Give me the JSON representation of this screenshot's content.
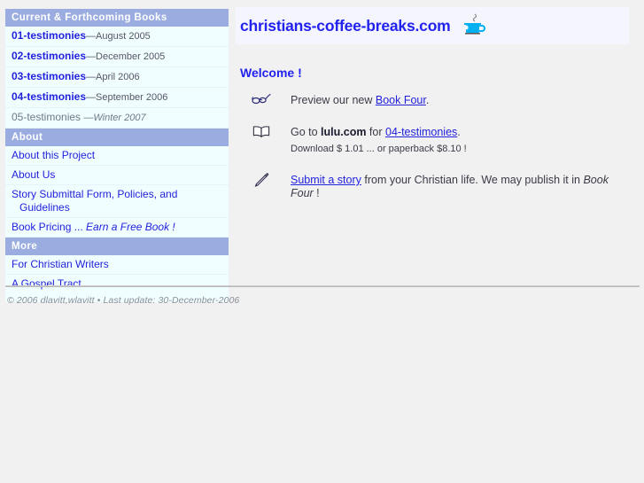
{
  "site": {
    "title": "christians-coffee-breaks.com",
    "logo_icon": "coffee-cup-icon"
  },
  "sidebar": {
    "sections": [
      {
        "header": "Current & Forthcoming Books",
        "items": [
          {
            "label": "01-testimonies",
            "dash": "—",
            "date": "August 2005",
            "link": true,
            "bold": true,
            "italic_date": false
          },
          {
            "label": "02-testimonies",
            "dash": "—",
            "date": "December 2005",
            "link": true,
            "bold": true,
            "italic_date": false
          },
          {
            "label": "03-testimonies",
            "dash": "—",
            "date": "April 2006",
            "link": true,
            "bold": true,
            "italic_date": false
          },
          {
            "label": "04-testimonies",
            "dash": "—",
            "date": "September 2006",
            "link": true,
            "bold": true,
            "italic_date": false
          },
          {
            "label": "05-testimonies",
            "dash": "—",
            "date": "Winter 2007",
            "link": false,
            "bold": false,
            "italic_date": true
          }
        ]
      },
      {
        "header": "About",
        "items": [
          {
            "label": "About this Project",
            "dash": "",
            "date": "",
            "link": true,
            "bold": false,
            "italic_date": false
          },
          {
            "label": "About Us",
            "dash": "",
            "date": "",
            "link": true,
            "bold": false,
            "italic_date": false
          },
          {
            "label": "Story Submittal Form, Policies, and",
            "label2": "Guidelines",
            "dash": "",
            "date": "",
            "link": true,
            "bold": false,
            "italic_date": false
          },
          {
            "label": "Book Pricing ...",
            "emphasis": "Earn a Free Book !",
            "dash": "",
            "date": "",
            "link": true,
            "bold": false,
            "italic_date": false
          }
        ]
      },
      {
        "header": "More",
        "items": [
          {
            "label": "For Christian Writers",
            "dash": "",
            "date": "",
            "link": true,
            "bold": false,
            "italic_date": false
          },
          {
            "label": "A Gospel Tract",
            "dash": "",
            "date": "",
            "link": true,
            "bold": false,
            "italic_date": false
          }
        ]
      }
    ]
  },
  "main": {
    "welcome_heading": "Welcome !",
    "features": [
      {
        "icon": "eyeglasses-icon",
        "text_before": "Preview our new ",
        "link_text": "Book Four",
        "text_after": ".",
        "sub_line": ""
      },
      {
        "icon": "open-book-icon",
        "text_before": "Go to ",
        "strong_text": "lulu.com",
        "text_middle": " for ",
        "link_text": "04-testimonies",
        "text_after": ".",
        "sub_line": "Download $ 1.01 ... or paperback $8.10 !"
      },
      {
        "icon": "pencil-icon",
        "link_text": "Submit a story",
        "text_after": " from your Christian life. We may publish it in ",
        "italic_text": "Book Four",
        "text_end": " !",
        "sub_line": ""
      }
    ]
  },
  "footer": {
    "text": "© 2006 dlavitt,wlavitt • Last update: 30-December-2006"
  },
  "colors": {
    "section_header_bg": "#9aace0",
    "sidebar_bg": "#f1feff",
    "banner_bg": "#f5f5fd",
    "link": "#2222dd",
    "title": "#2222ee",
    "page_bg": "#f1f1f1",
    "coffee_cup": "#00b0f0",
    "footer_text": "#8a8e99"
  }
}
